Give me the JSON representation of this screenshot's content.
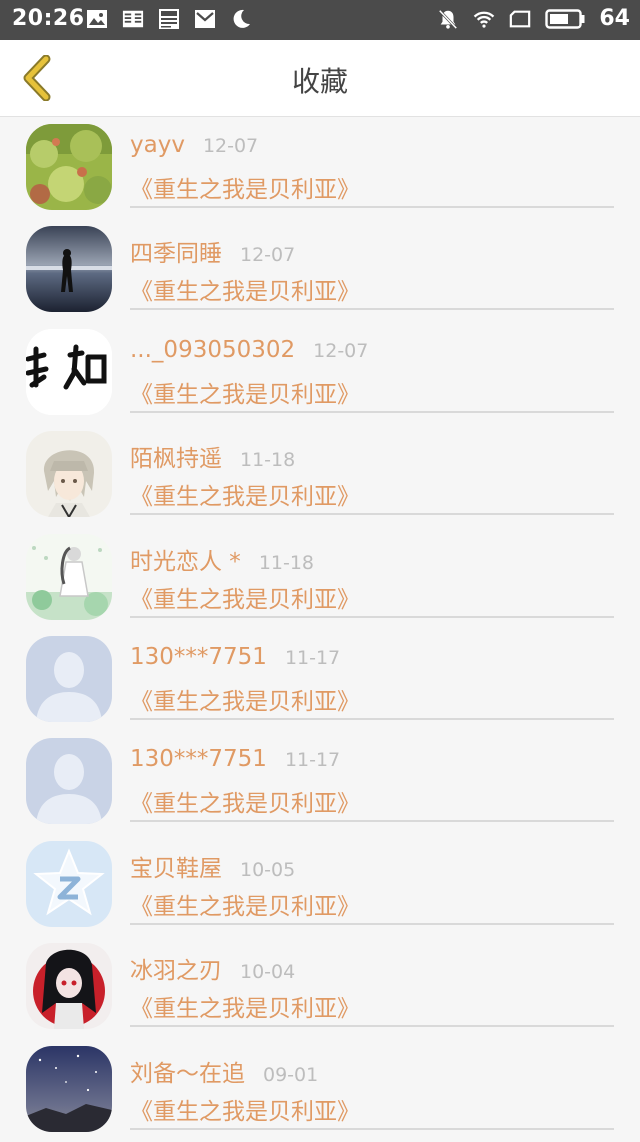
{
  "status_bar": {
    "time": "20:26",
    "battery": "64",
    "left_icons": [
      "image-icon",
      "reader-icon",
      "news-icon",
      "mail-icon",
      "moon-icon"
    ],
    "right_icons": [
      "mute-icon",
      "wifi-icon",
      "screen-icon",
      "battery-icon"
    ]
  },
  "header": {
    "title": "收藏"
  },
  "items": [
    {
      "name": "yayv",
      "date": "12-07",
      "book": "《重生之我是贝利亚》"
    },
    {
      "name": "四季同睡",
      "date": "12-07",
      "book": "《重生之我是贝利亚》"
    },
    {
      "name": "..._093050302",
      "date": "12-07",
      "book": "《重生之我是贝利亚》"
    },
    {
      "name": "陌枫持遥",
      "date": "11-18",
      "book": "《重生之我是贝利亚》"
    },
    {
      "name": "时光恋人 *",
      "date": "11-18",
      "book": "《重生之我是贝利亚》"
    },
    {
      "name": "130***7751",
      "date": "11-17",
      "book": "《重生之我是贝利亚》"
    },
    {
      "name": "130***7751",
      "date": "11-17",
      "book": "《重生之我是贝利亚》"
    },
    {
      "name": "宝贝鞋屋",
      "date": "10-05",
      "book": "《重生之我是贝利亚》"
    },
    {
      "name": "冰羽之刃",
      "date": "10-04",
      "book": "《重生之我是贝利亚》"
    },
    {
      "name": "刘备～在追",
      "date": "09-01",
      "book": "《重生之我是贝利亚》"
    }
  ],
  "avatars": [
    "leaf-photo",
    "lake-silhouette",
    "calligraphy",
    "anime-boy",
    "anime-girl-flowers",
    "default-user",
    "default-user",
    "qzone-star",
    "anime-girl-red",
    "night-sky"
  ],
  "colors": {
    "accent": "#e09a64",
    "date": "#bdbdbd",
    "statusbar": "#4b4b4b",
    "back_arrow": "#e6c23a"
  }
}
